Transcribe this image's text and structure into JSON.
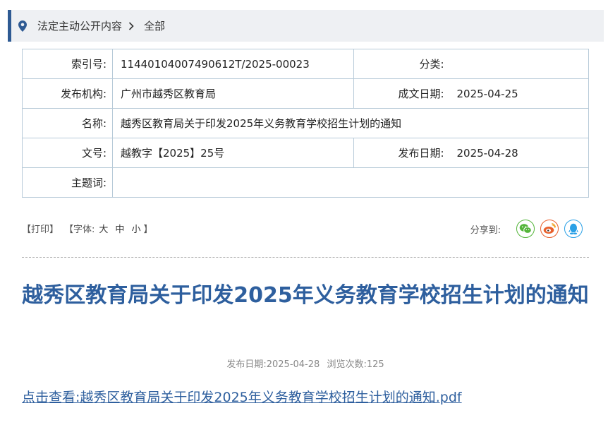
{
  "breadcrumb": {
    "section": "法定主动公开内容",
    "current": "全部"
  },
  "meta": {
    "index_label": "索引号:",
    "index_value": "11440104007490612T/2025-00023",
    "category_label": "分类:",
    "category_value": "",
    "publisher_label": "发布机构:",
    "publisher_value": "广州市越秀区教育局",
    "written_date_label": "成文日期:",
    "written_date_value": "2025-04-25",
    "name_label": "名称:",
    "name_value": "越秀区教育局关于印发2025年义务教育学校招生计划的通知",
    "doc_no_label": "文号:",
    "doc_no_value": "越教字【2025】25号",
    "publish_date_label": "发布日期:",
    "publish_date_value": "2025-04-28",
    "keywords_label": "主题词:",
    "keywords_value": ""
  },
  "tools": {
    "print": "【打印】",
    "font_prefix": "【字体:",
    "font_large": "大",
    "font_medium": "中",
    "font_small": "小",
    "font_suffix": "】"
  },
  "share": {
    "label": "分享到:",
    "icons": [
      "wechat-icon",
      "weibo-icon",
      "qq-icon"
    ]
  },
  "article": {
    "title": "越秀区教育局关于印发2025年义务教育学校招生计划的通知",
    "publish_date_label": "发布日期:",
    "publish_date": "2025-04-28",
    "views_label": "浏览次数:",
    "views": "125",
    "attachment_link": "点击查看:越秀区教育局关于印发2025年义务教育学校招生计划的通知.pdf"
  },
  "colors": {
    "accent": "#2e5f9e",
    "table_border": "#b7cad8",
    "crumb_bg": "#eef0f3"
  }
}
